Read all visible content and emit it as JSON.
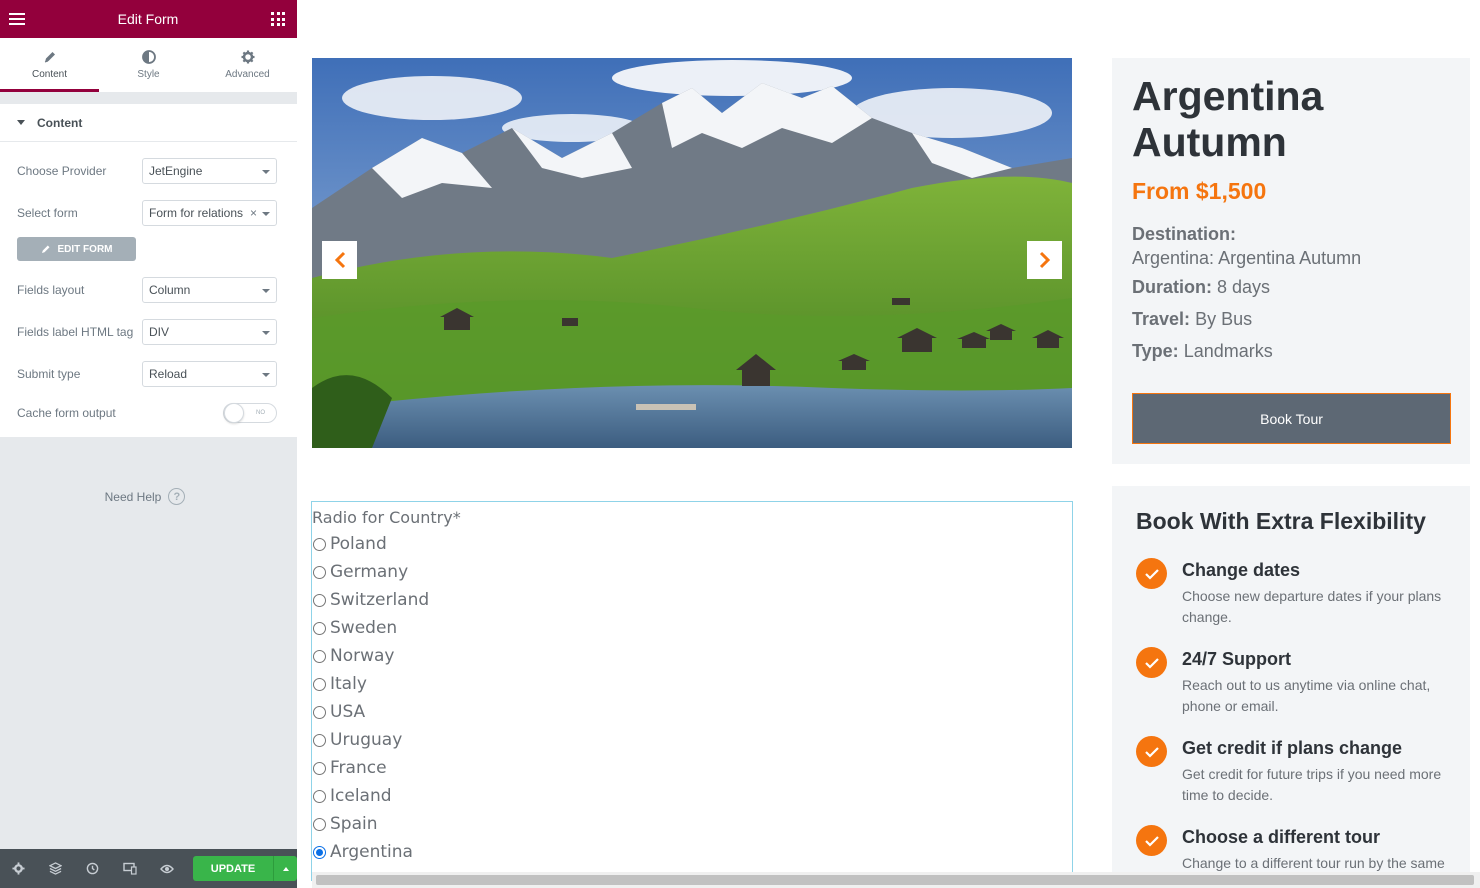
{
  "panel": {
    "title": "Edit Form",
    "tabs": [
      {
        "label": "Content",
        "icon": "pencil-icon"
      },
      {
        "label": "Style",
        "icon": "contrast-icon"
      },
      {
        "label": "Advanced",
        "icon": "gear-icon"
      }
    ],
    "section_title": "Content",
    "controls": {
      "provider_label": "Choose Provider",
      "provider_value": "JetEngine",
      "form_label": "Select form",
      "form_value": "Form for relations",
      "edit_button": "EDIT FORM",
      "layout_label": "Fields layout",
      "layout_value": "Column",
      "tag_label": "Fields label HTML tag",
      "tag_value": "DIV",
      "submit_label": "Submit type",
      "submit_value": "Reload",
      "cache_label": "Cache form output",
      "cache_value": "NO"
    },
    "help": "Need Help",
    "footer": {
      "update_label": "UPDATE",
      "icons": [
        "settings-icon",
        "layers-icon",
        "history-icon",
        "responsive-icon",
        "preview-eye-icon"
      ]
    }
  },
  "slider": {
    "alt": "Mountain valley with lake and chalets"
  },
  "form": {
    "label": "Radio for Country*",
    "options": [
      "Poland",
      "Germany",
      "Switzerland",
      "Sweden",
      "Norway",
      "Italy",
      "USA",
      "Uruguay",
      "France",
      "Iceland",
      "Spain",
      "Argentina"
    ],
    "selected": "Argentina"
  },
  "tour": {
    "title": "Argentina Autumn",
    "price": "From $1,500",
    "destination_label": "Destination:",
    "destination_value": "Argentina: Argentina Autumn",
    "duration_label": "Duration:",
    "duration_value": "8 days",
    "travel_label": "Travel:",
    "travel_value": "By Bus",
    "type_label": "Type:",
    "type_value": "Landmarks",
    "book_button": "Book Tour"
  },
  "flexibility": {
    "title": "Book With Extra Flexibility",
    "features": [
      {
        "title": "Change dates",
        "text": "Choose new departure dates if your plans change."
      },
      {
        "title": "24/7 Support",
        "text": "Reach out to us anytime via online chat, phone or email."
      },
      {
        "title": "Get credit if plans change",
        "text": "Get credit for future trips if you need more time to decide."
      },
      {
        "title": "Choose a different tour",
        "text": "Change to a different tour run by the same"
      }
    ]
  },
  "colors": {
    "brand": "#93003c",
    "accent": "#f5750f",
    "update": "#39b54a"
  }
}
